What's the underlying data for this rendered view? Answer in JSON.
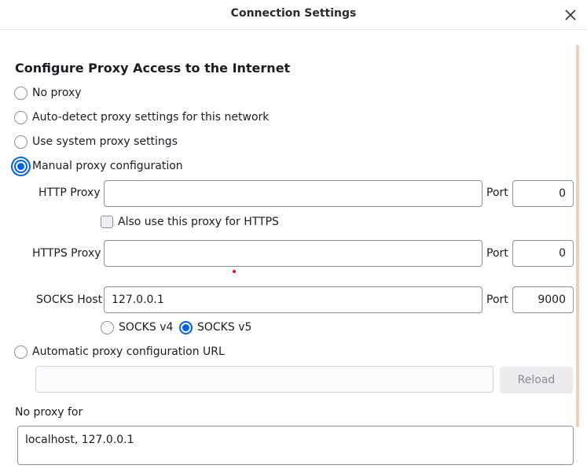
{
  "window": {
    "title": "Connection Settings"
  },
  "heading": "Configure Proxy Access to the Internet",
  "proxy_options": [
    {
      "label": "No proxy",
      "checked": false
    },
    {
      "label": "Auto-detect proxy settings for this network",
      "checked": false
    },
    {
      "label": "Use system proxy settings",
      "checked": false
    },
    {
      "label": "Manual proxy configuration",
      "checked": true
    }
  ],
  "http": {
    "label": "HTTP Proxy",
    "value": "",
    "port_label": "Port",
    "port": "0"
  },
  "https_checkbox": {
    "label": "Also use this proxy for HTTPS",
    "checked": false
  },
  "https": {
    "label": "HTTPS Proxy",
    "value": "",
    "port_label": "Port",
    "port": "0"
  },
  "socks": {
    "label": "SOCKS Host",
    "value": "127.0.0.1",
    "port_label": "Port",
    "port": "9000",
    "v4_label": "SOCKS v4",
    "v5_label": "SOCKS v5",
    "selected_version": "v5"
  },
  "auto_config": {
    "label": "Automatic proxy configuration URL",
    "value": "",
    "reload_label": "Reload"
  },
  "no_proxy": {
    "label": "No proxy for",
    "value": "localhost, 127.0.0.1"
  },
  "colors": {
    "accent": "#0061e0",
    "pointer_marker": "#e0101a"
  }
}
